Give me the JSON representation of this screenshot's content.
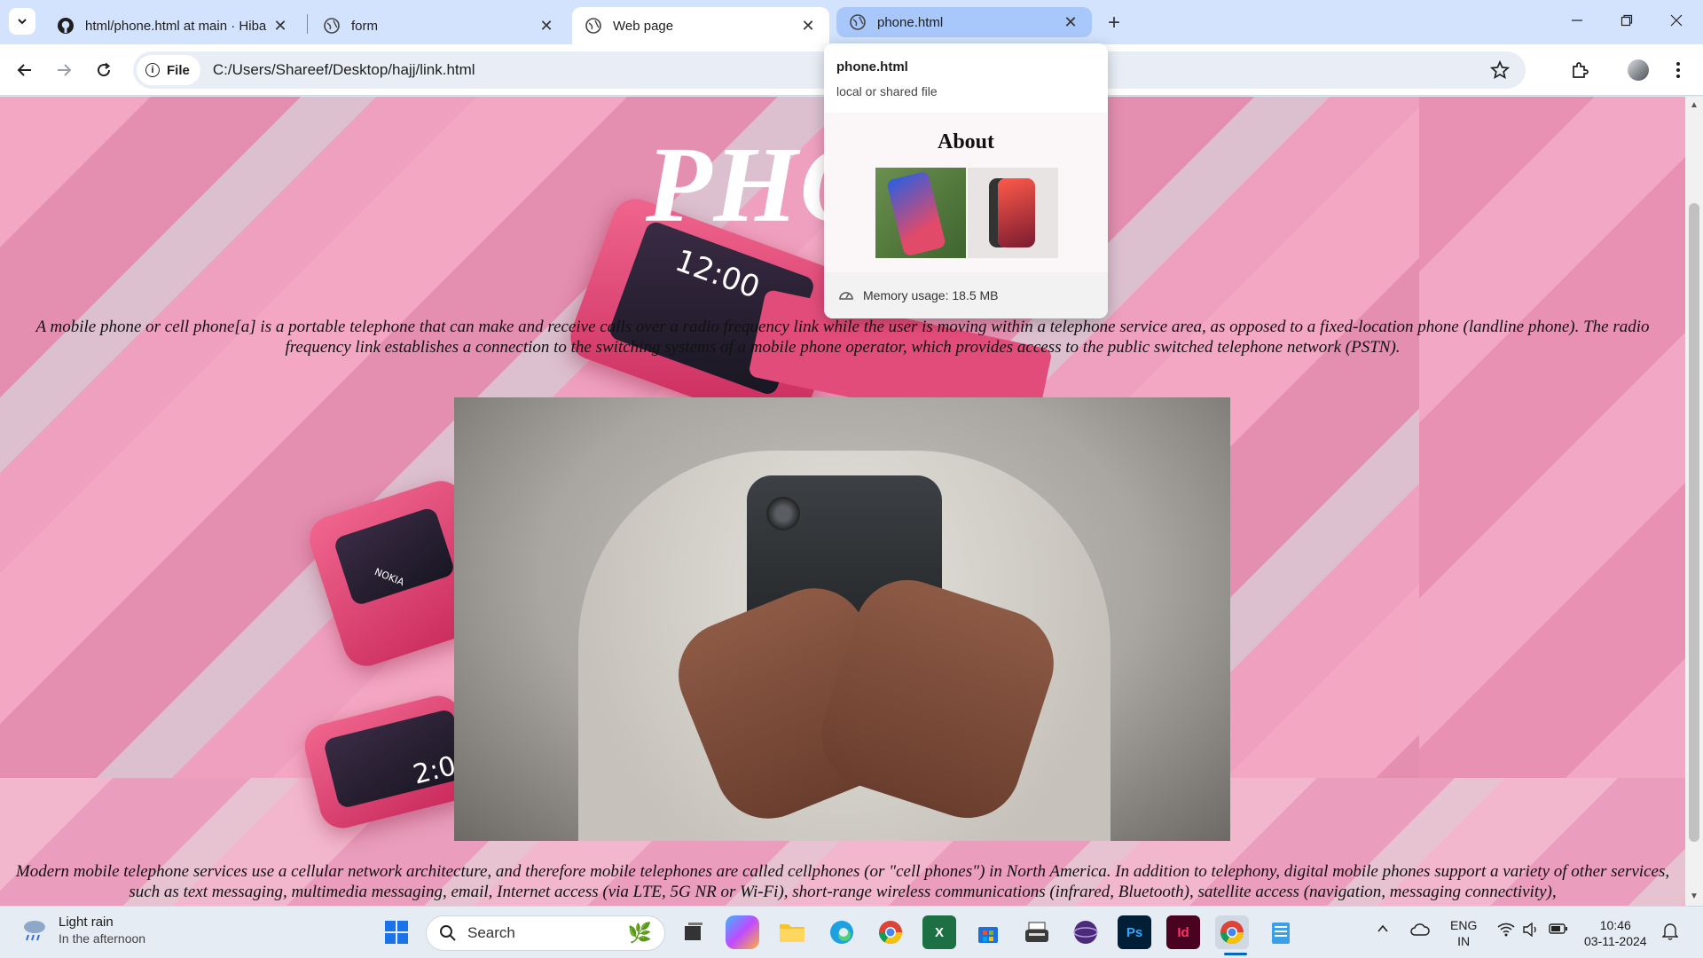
{
  "browser": {
    "tabs": [
      {
        "title": "html/phone.html at main · Hiba",
        "icon": "github-icon",
        "state": "normal"
      },
      {
        "title": "form",
        "icon": "globe-icon",
        "state": "normal"
      },
      {
        "title": "Web page",
        "icon": "globe-icon",
        "state": "active"
      },
      {
        "title": "phone.html",
        "icon": "globe-icon",
        "state": "hovered"
      }
    ],
    "address": {
      "scheme_label": "File",
      "url": "C:/Users/Shareef/Desktop/hajj/link.html"
    },
    "hover_card": {
      "title": "phone.html",
      "subtitle": "local or shared file",
      "preview_heading": "About",
      "memory": "Memory usage: 18.5 MB"
    }
  },
  "page": {
    "title": "PHO",
    "paragraph1": "A mobile phone or cell phone[a] is a portable telephone that can make and receive calls over a radio frequency link while the user is moving within a telephone service area, as opposed to a fixed-location phone (landline phone). The radio frequency link establishes a connection to the switching systems of a mobile phone operator, which provides access to the public switched telephone network (PSTN).",
    "paragraph2": "Modern mobile telephone services use a cellular network architecture, and therefore mobile telephones are called cellphones (or \"cell phones\") in North America. In addition to telephony, digital mobile phones support a variety of other services, such as text messaging, multimedia messaging, email, Internet access (via LTE, 5G NR or Wi-Fi), short-range wireless communications (infrared, Bluetooth), satellite access (navigation, messaging connectivity),",
    "deco_clock": "12:00",
    "deco_brand": "NOKIA",
    "deco_clock2": "2:00"
  },
  "taskbar": {
    "weather_line1": "Light rain",
    "weather_line2": "In the afternoon",
    "search_placeholder": "Search",
    "lang_line1": "ENG",
    "lang_line2": "IN",
    "time": "10:46",
    "date": "03-11-2024"
  }
}
